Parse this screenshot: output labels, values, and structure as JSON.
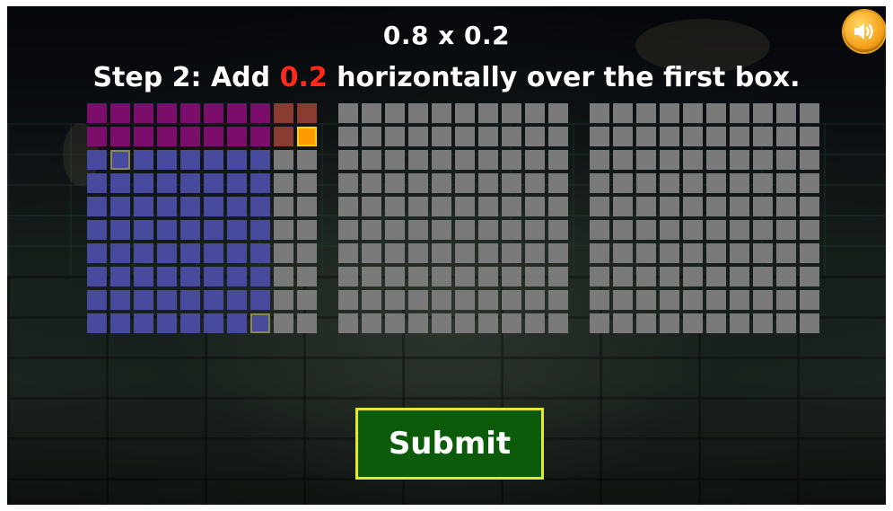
{
  "problem": {
    "expression": "0.8 x 0.2"
  },
  "instruction": {
    "prefix": "Step 2: Add ",
    "highlight": "0.2",
    "suffix": " horizontally over the first box."
  },
  "colors": {
    "highlight_text": "#ff2a1a",
    "first_factor_fill": "#484a9e",
    "overlap_fill": "#7b0d6b",
    "second_factor_fill": "#8a3c32",
    "empty_cell": "#7a7a7a",
    "selected_cell": "#ff9a00",
    "submit_bg": "#0b5b0b",
    "submit_border": "#e8e82a"
  },
  "grids": {
    "count": 3,
    "rows": 10,
    "cols": 10,
    "first_box": {
      "vertical_fill_columns": 8,
      "horizontal_fill_rows": 2,
      "selected_cell": {
        "row": 2,
        "col": 10
      }
    }
  },
  "sound_button": {
    "icon": "speaker-icon"
  },
  "submit": {
    "label": "Submit"
  }
}
